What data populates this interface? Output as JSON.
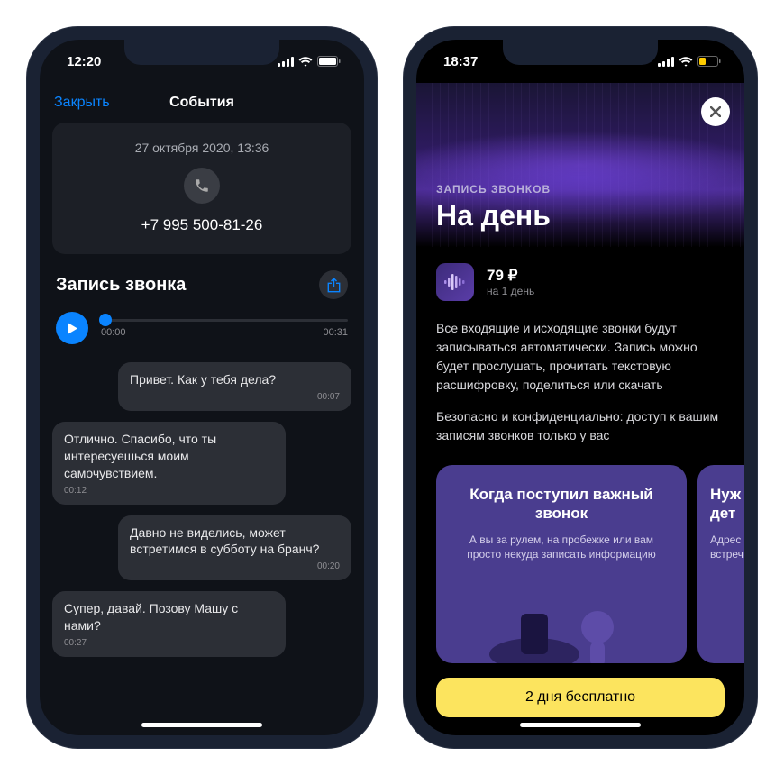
{
  "left": {
    "status": {
      "time": "12:20"
    },
    "nav": {
      "close": "Закрыть",
      "title": "События"
    },
    "card": {
      "date": "27 октября 2020, 13:36",
      "phone": "+7 995 500-81-26"
    },
    "section": {
      "title": "Запись звонка"
    },
    "player": {
      "start": "00:00",
      "end": "00:31"
    },
    "messages": [
      {
        "side": "r",
        "text": "Привет. Как у тебя дела?",
        "time": "00:07"
      },
      {
        "side": "l",
        "text": "Отлично. Спасибо, что ты интересуешься моим самочувствием.",
        "time": "00:12"
      },
      {
        "side": "r",
        "text": "Давно не виделись, может встретимся в субботу на бранч?",
        "time": "00:20"
      },
      {
        "side": "l",
        "text": "Супер, давай. Позову Машу с нами?",
        "time": "00:27"
      }
    ]
  },
  "right": {
    "status": {
      "time": "18:37"
    },
    "hero": {
      "eyebrow": "ЗАПИСЬ ЗВОНКОВ",
      "title": "На день"
    },
    "price": {
      "amount": "79 ₽",
      "sub": "на 1 день"
    },
    "desc1": "Все входящие и исходящие звонки будут записываться автоматически. Запись можно будет прослушать, прочитать текстовую расшифровку, поделиться или скачать",
    "desc2": "Безопасно и конфиденциально: доступ к вашим записям звонков только у вас",
    "pcards": [
      {
        "title": "Когда поступил важный звонок",
        "sub": "А вы за рулем, на пробежке или вам просто некуда записать информацию"
      },
      {
        "title": "Нуж дет",
        "sub": "Адрес встречи"
      }
    ],
    "cta": "2 дня бесплатно"
  }
}
